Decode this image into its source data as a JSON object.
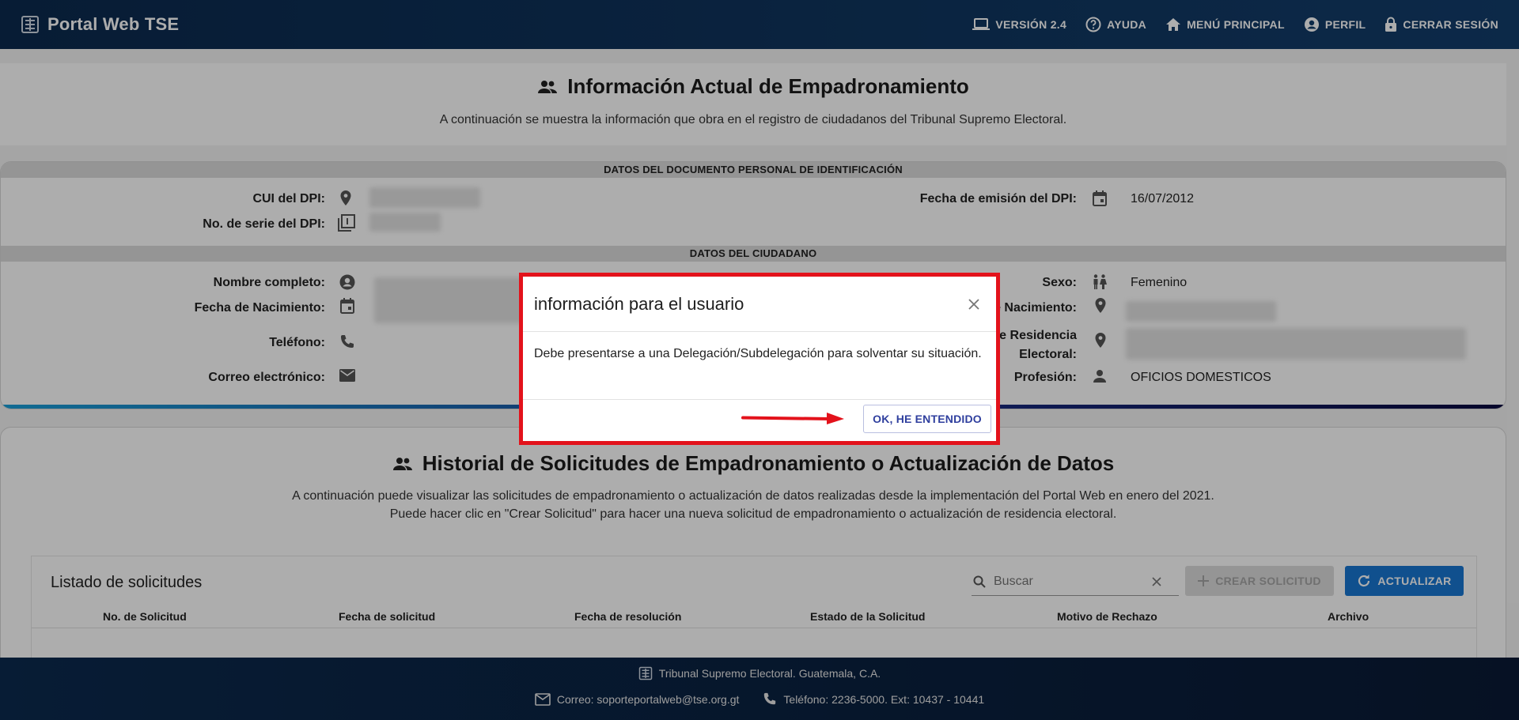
{
  "header": {
    "brand": "Portal Web TSE",
    "nav": [
      {
        "label": "VERSIÓN 2.4",
        "icon": "laptop-icon"
      },
      {
        "label": "AYUDA",
        "icon": "help-icon"
      },
      {
        "label": "MENÚ PRINCIPAL",
        "icon": "home-icon"
      },
      {
        "label": "PERFIL",
        "icon": "account-icon"
      },
      {
        "label": "CERRAR SESIÓN",
        "icon": "lock-icon"
      }
    ]
  },
  "info": {
    "title": "Información Actual de Empadronamiento",
    "subtitle": "A continuación se muestra la información que obra en el registro de ciudadanos del Tribunal Supremo Electoral."
  },
  "dpi": {
    "band": "DATOS DEL DOCUMENTO PERSONAL DE IDENTIFICACIÓN",
    "cui_label": "CUI del DPI:",
    "serie_label": "No. de serie del DPI:",
    "emision_label": "Fecha de emisión del DPI:",
    "emision_value": "16/07/2012"
  },
  "ciudadano": {
    "band": "DATOS DEL CIUDADANO",
    "nombre_label": "Nombre completo:",
    "nacimiento_label": "Fecha de Nacimiento:",
    "telefono_label": "Teléfono:",
    "correo_label": "Correo electrónico:",
    "sexo_label": "Sexo:",
    "sexo_value": "Femenino",
    "lugar_label": "e Nacimiento:",
    "residencia_label_1": "le Residencia",
    "residencia_label_2": "Electoral:",
    "profesion_label": "Profesión:",
    "profesion_value": "OFICIOS DOMESTICOS"
  },
  "historial": {
    "title": "Historial de Solicitudes de Empadronamiento o Actualización de Datos",
    "sub_1": "A continuación puede visualizar las solicitudes de empadronamiento o actualización de datos realizadas desde la implementación del Portal Web en enero del 2021.",
    "sub_2": "Puede hacer clic en \"Crear Solicitud\" para hacer una nueva solicitud de empadronamiento o actualización de residencia electoral.",
    "list_title": "Listado de solicitudes",
    "search_placeholder": "Buscar",
    "crear_label": "CREAR SOLICITUD",
    "actualizar_label": "ACTUALIZAR",
    "columns": [
      "No. de Solicitud",
      "Fecha de solicitud",
      "Fecha de resolución",
      "Estado de la Solicitud",
      "Motivo de Rechazo",
      "Archivo"
    ]
  },
  "footer": {
    "org": "Tribunal Supremo Electoral. Guatemala, C.A.",
    "correo": "Correo: soporteportalweb@tse.org.gt",
    "telefono": "Teléfono: 2236-5000. Ext: 10437 - 10441"
  },
  "modal": {
    "title": "información para el usuario",
    "body": "Debe presentarse a una Delegación/Subdelegación para solventar su situación.",
    "ok_label": "OK, HE ENTENDIDO"
  },
  "colors": {
    "header_bg": "#0b2a4e",
    "primary": "#1976d2",
    "highlight_red": "#e3121b"
  }
}
